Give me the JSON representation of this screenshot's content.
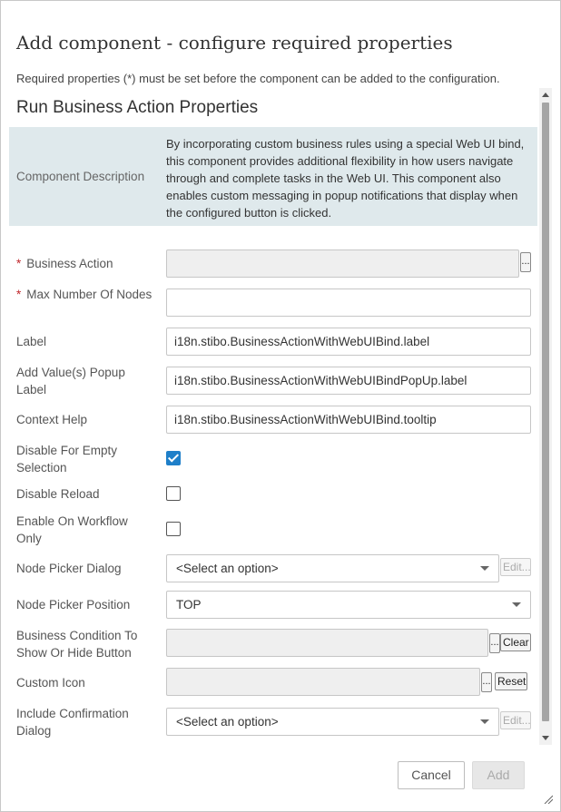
{
  "dialog": {
    "title": "Add component - configure required properties",
    "subtitle": "Required properties (*) must be set before the component can be added to the configuration.",
    "section_title": "Run Business Action Properties"
  },
  "description": {
    "label": "Component Description",
    "text": "By incorporating custom business rules using a special Web UI bind, this component provides additional flexibility in how users navigate through and complete tasks in the Web UI. This component also enables custom messaging in popup notifications that display when the configured button is clicked."
  },
  "fields": {
    "business_action": {
      "required": "*",
      "label": "Business Action",
      "value": "",
      "browse": "..."
    },
    "max_nodes": {
      "required": "*",
      "label": "Max Number Of Nodes",
      "value": ""
    },
    "label": {
      "label": "Label",
      "value": "i18n.stibo.BusinessActionWithWebUIBind.label"
    },
    "add_values_popup": {
      "label": "Add Value(s) Popup Label",
      "value": "i18n.stibo.BusinessActionWithWebUIBindPopUp.label"
    },
    "context_help": {
      "label": "Context Help",
      "value": "i18n.stibo.BusinessActionWithWebUIBind.tooltip"
    },
    "disable_empty": {
      "label": "Disable For Empty Selection",
      "checked": true
    },
    "disable_reload": {
      "label": "Disable Reload",
      "checked": false
    },
    "enable_workflow": {
      "label": "Enable On Workflow Only",
      "checked": false
    },
    "node_picker_dialog": {
      "label": "Node Picker Dialog",
      "selected": "<Select an option>",
      "edit": "Edit..."
    },
    "node_picker_position": {
      "label": "Node Picker Position",
      "selected": "TOP"
    },
    "business_condition": {
      "label": "Business Condition To Show Or Hide Button",
      "value": "",
      "browse": "...",
      "clear": "Clear"
    },
    "custom_icon": {
      "label": "Custom Icon",
      "value": "",
      "browse": "...",
      "reset": "Reset"
    },
    "confirmation_dialog": {
      "label": "Include Confirmation Dialog",
      "selected": "<Select an option>",
      "edit": "Edit..."
    }
  },
  "footer": {
    "cancel": "Cancel",
    "add": "Add"
  },
  "colors": {
    "accent": "#1e7fc9",
    "required": "#c0282d",
    "description_bg": "#dfe9ec"
  }
}
